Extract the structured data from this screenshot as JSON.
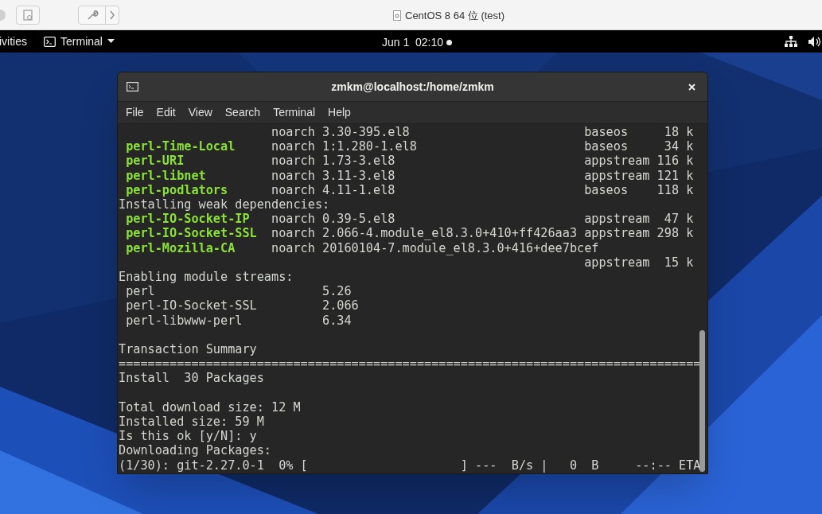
{
  "host_window": {
    "title": "CentOS 8 64 位 (test)"
  },
  "top_bar": {
    "activities": "ivities",
    "app_menu": "Terminal",
    "clock": "Jun 1  02:10",
    "notification_dot": true
  },
  "terminal": {
    "title": "zmkm@localhost:/home/zmkm",
    "menu": [
      "File",
      "Edit",
      "View",
      "Search",
      "Terminal",
      "Help"
    ],
    "lines": [
      {
        "kind": "package",
        "arch": "noarch",
        "version": "3.30-395.el8",
        "repo": "baseos",
        "size": "18 k"
      },
      {
        "kind": "package",
        "name": "perl-Time-Local",
        "arch": "noarch",
        "version": "1:1.280-1.el8",
        "repo": "baseos",
        "size": "34 k"
      },
      {
        "kind": "package",
        "name": "perl-URI",
        "arch": "noarch",
        "version": "1.73-3.el8",
        "repo": "appstream",
        "size": "116 k"
      },
      {
        "kind": "package",
        "name": "perl-libnet",
        "arch": "noarch",
        "version": "3.11-3.el8",
        "repo": "appstream",
        "size": "121 k"
      },
      {
        "kind": "package",
        "name": "perl-podlators",
        "arch": "noarch",
        "version": "4.11-1.el8",
        "repo": "baseos",
        "size": "118 k"
      },
      {
        "kind": "text",
        "text": "Installing weak dependencies:"
      },
      {
        "kind": "package",
        "name": "perl-IO-Socket-IP",
        "arch": "noarch",
        "version": "0.39-5.el8",
        "repo": "appstream",
        "size": "47 k"
      },
      {
        "kind": "package",
        "name": "perl-IO-Socket-SSL",
        "arch": "noarch",
        "version": "2.066-4.module_el8.3.0+410+ff426aa3",
        "repo": "appstream",
        "size": "298 k"
      },
      {
        "kind": "package",
        "name": "perl-Mozilla-CA",
        "arch": "noarch",
        "version": "20160104-7.module_el8.3.0+416+dee7bcef",
        "repo": "appstream",
        "size": "15 k"
      },
      {
        "kind": "text",
        "text": "Enabling module streams:"
      },
      {
        "kind": "module",
        "name": "perl",
        "stream": "5.26"
      },
      {
        "kind": "module",
        "name": "perl-IO-Socket-SSL",
        "stream": "2.066"
      },
      {
        "kind": "module",
        "name": "perl-libwww-perl",
        "stream": "6.34"
      },
      {
        "kind": "blank"
      },
      {
        "kind": "text",
        "text": "Transaction Summary"
      },
      {
        "kind": "text",
        "text": "================================================================================"
      },
      {
        "kind": "text",
        "text": "Install  30 Packages"
      },
      {
        "kind": "blank"
      },
      {
        "kind": "text",
        "text": "Total download size: 12 M"
      },
      {
        "kind": "text",
        "text": "Installed size: 59 M"
      },
      {
        "kind": "text",
        "text": "Is this ok [y/N]: y"
      },
      {
        "kind": "text",
        "text": "Downloading Packages:"
      },
      {
        "kind": "text",
        "text": "(1/30): git-2.27.0-1  0% [                     ] ---  B/s |   0  B     --:-- ETA"
      }
    ]
  }
}
